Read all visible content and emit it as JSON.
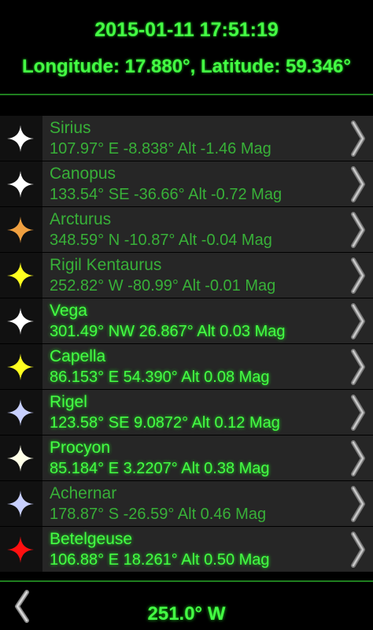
{
  "header": {
    "datetime": "2015-01-11 17:51:19",
    "coordinates": "Longitude: 17.880°, Latitude: 59.346°"
  },
  "stars": [
    {
      "name": "Sirius",
      "info": "107.97° E  -8.838° Alt  -1.46 Mag",
      "star_color": "#ffffff",
      "icon": "white-star-icon",
      "visible": false
    },
    {
      "name": "Canopus",
      "info": "133.54° SE  -36.66° Alt  -0.72 Mag",
      "star_color": "#ffffff",
      "icon": "white-star-icon",
      "visible": false
    },
    {
      "name": "Arcturus",
      "info": "348.59° N  -10.87° Alt  -0.04 Mag",
      "star_color": "#f0a040",
      "icon": "orange-star-icon",
      "visible": false
    },
    {
      "name": "Rigil Kentaurus",
      "info": "252.82° W  -80.99° Alt  -0.01 Mag",
      "star_color": "#ffff20",
      "icon": "yellow-star-icon",
      "visible": false
    },
    {
      "name": "Vega",
      "info": "301.49° NW  26.867° Alt  0.03 Mag",
      "star_color": "#ffffff",
      "icon": "white-star-icon",
      "visible": true
    },
    {
      "name": "Capella",
      "info": "86.153° E  54.390° Alt  0.08 Mag",
      "star_color": "#ffff20",
      "icon": "yellow-star-icon",
      "visible": true
    },
    {
      "name": "Rigel",
      "info": "123.58° SE  9.0872° Alt  0.12 Mag",
      "star_color": "#c8d0ff",
      "icon": "blue-white-star-icon",
      "visible": true
    },
    {
      "name": "Procyon",
      "info": "85.184° E  3.2207° Alt  0.38 Mag",
      "star_color": "#ffffe8",
      "icon": "white-star-icon",
      "visible": true
    },
    {
      "name": "Achernar",
      "info": "178.87° S  -26.59° Alt  0.46 Mag",
      "star_color": "#c8d0ff",
      "icon": "blue-white-star-icon",
      "visible": false
    },
    {
      "name": "Betelgeuse",
      "info": "106.88° E  18.261° Alt  0.50 Mag",
      "star_color": "#ff1010",
      "icon": "red-star-icon",
      "visible": true
    }
  ],
  "footer": {
    "azimuth": "251.0° W"
  },
  "colors": {
    "text_bright": "#44ff44",
    "text_dim": "#38b038",
    "row_background": "#262626"
  }
}
